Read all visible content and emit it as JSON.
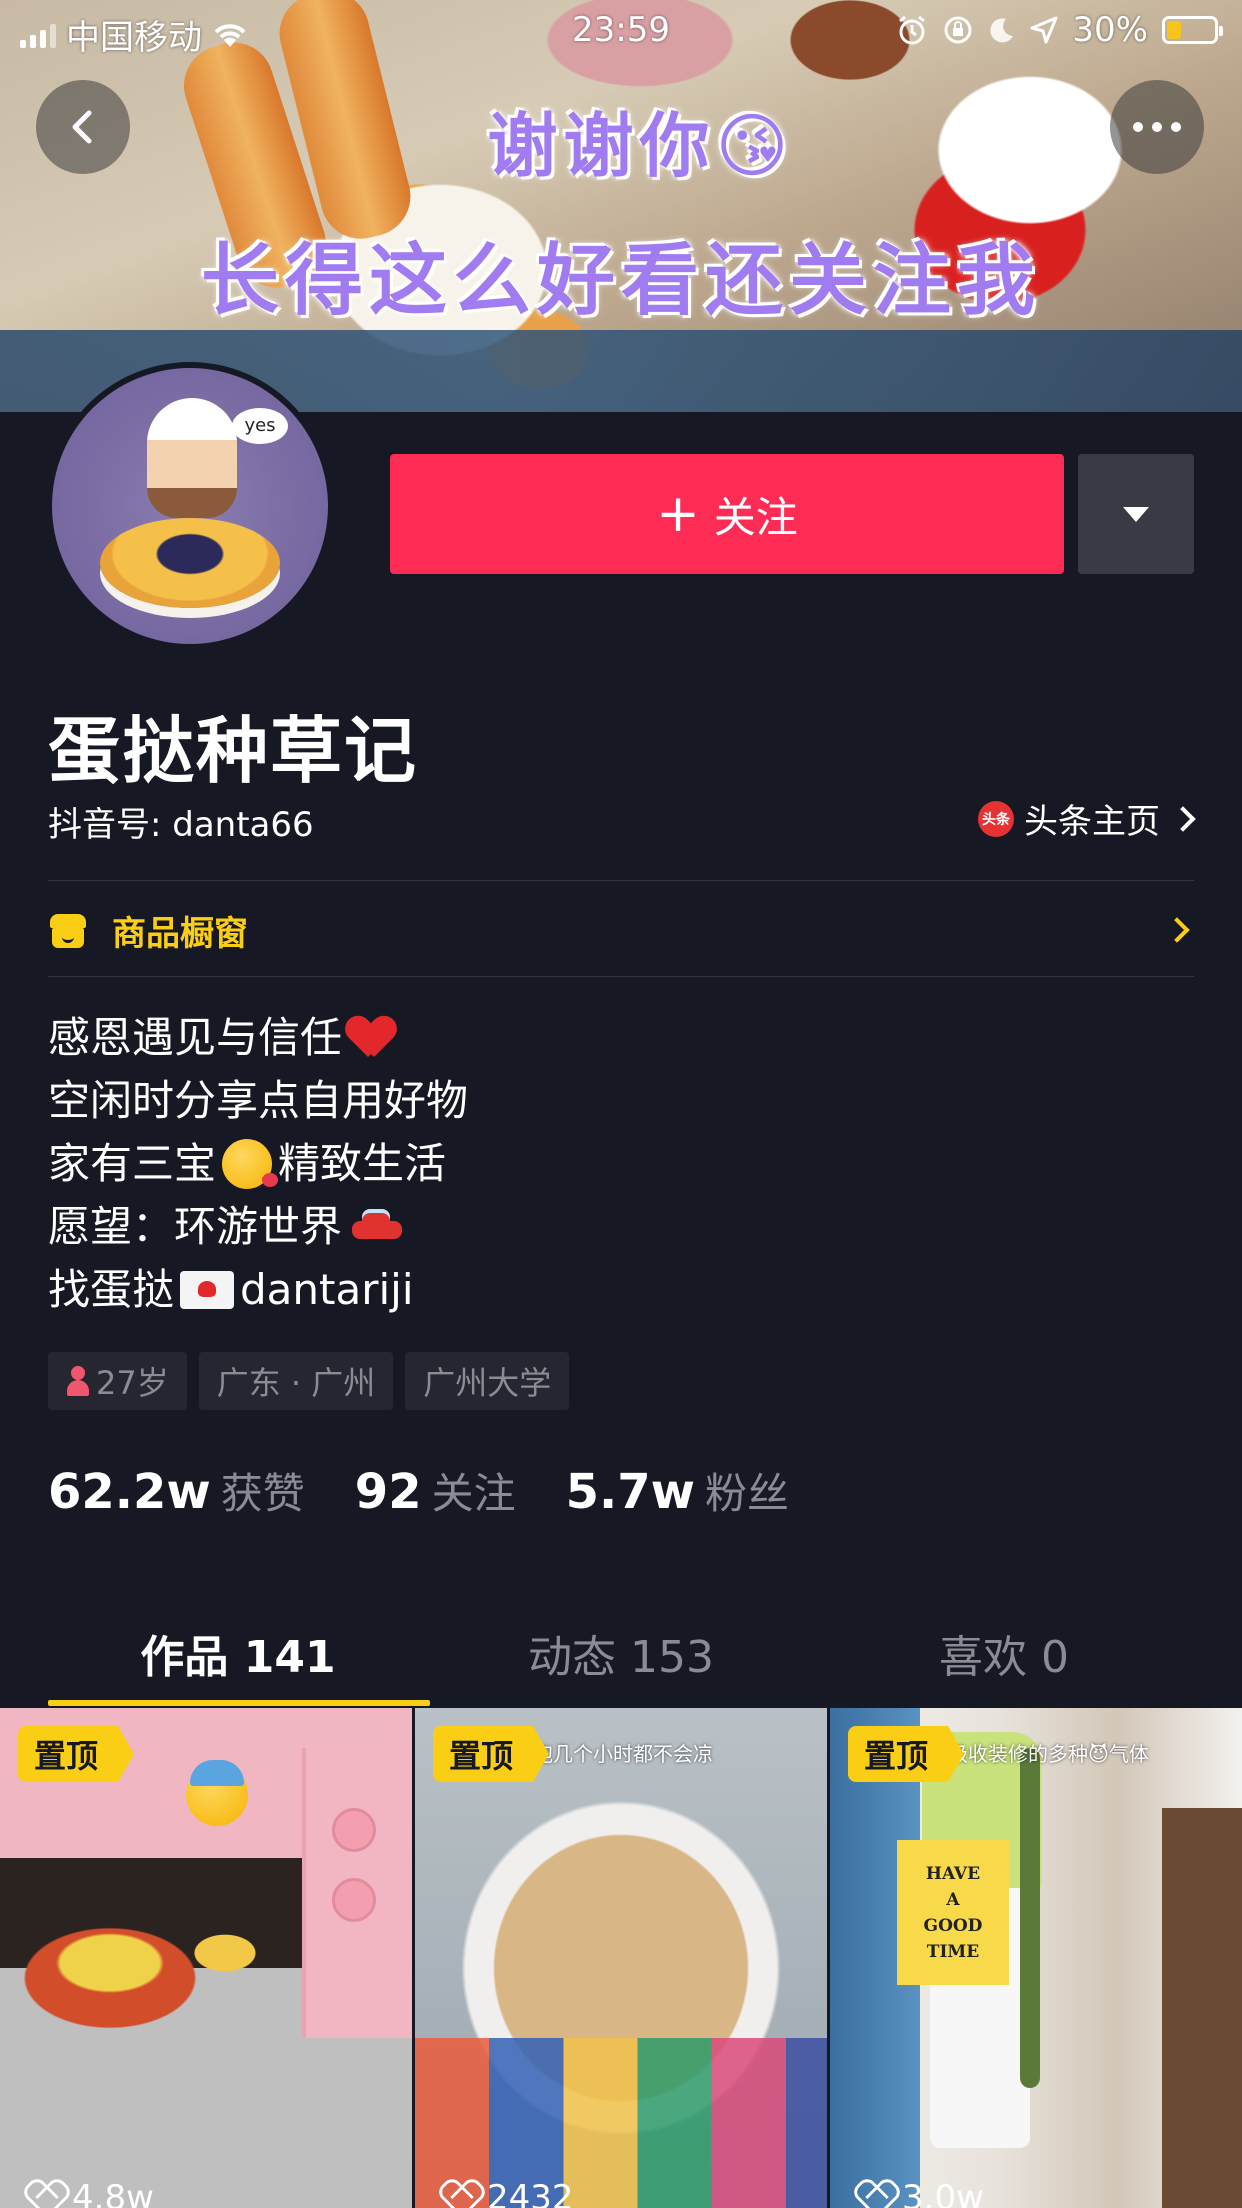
{
  "status_bar": {
    "carrier": "中国移动",
    "time": "23:59",
    "battery": "30%",
    "battery_level": 0.3,
    "icons": [
      "signal-icon",
      "wifi-icon",
      "alarm-icon",
      "rotation-lock-icon",
      "moon-icon",
      "location-icon",
      "battery-icon"
    ]
  },
  "cover": {
    "caption_line1": "谢谢你😘",
    "caption_line2": "长得这么好看还关注我"
  },
  "header": {
    "back_icon": "chevron-left-icon",
    "more_icon": "more-dots-icon"
  },
  "profile": {
    "name": "蛋挞种草记",
    "douyin_id": "抖音号: danta66",
    "avatar_text": "yes",
    "toutiao_label": "头条主页",
    "toutiao_icon_text": "头条",
    "follow_label": "关注",
    "follow_icon": "+",
    "shop_label": "商品橱窗"
  },
  "bio": {
    "lines": [
      "感恩遇见与信任",
      "空闲时分享点自用好物",
      "家有三宝",
      "精致生活",
      "愿望：环游世界",
      "找蛋挞",
      "dantariji"
    ]
  },
  "tags": [
    "27岁",
    "广东 · 广州",
    "广州大学"
  ],
  "stats": [
    {
      "num": "62.2w",
      "label": "获赞"
    },
    {
      "num": "92",
      "label": "关注"
    },
    {
      "num": "5.7w",
      "label": "粉丝"
    }
  ],
  "tabs": [
    {
      "label": "作品 141",
      "active": true
    },
    {
      "label": "动态 153",
      "active": false
    },
    {
      "label": "喜欢 0",
      "active": false
    }
  ],
  "videos": [
    {
      "pin": "置顶",
      "overlay": "",
      "likes": "4.8w"
    },
    {
      "pin": "置顶",
      "overlay": "泡几个小时都不会凉",
      "likes": "2432"
    },
    {
      "pin": "置顶",
      "overlay": "级收装修的多种😈气体",
      "likes": "3.0w",
      "sign": [
        "HAVE",
        "A",
        "GOOD",
        "TIME"
      ]
    }
  ],
  "colors": {
    "background": "#161823",
    "follow": "#fe2c55",
    "accent_yellow": "#face15",
    "muted_text": "#8a8b93"
  }
}
